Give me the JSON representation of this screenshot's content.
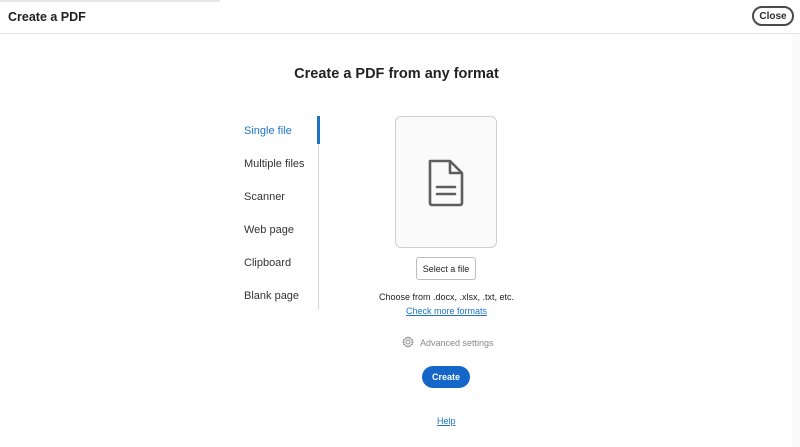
{
  "header": {
    "title": "Create a PDF",
    "close_label": "Close"
  },
  "main": {
    "heading": "Create a PDF from any format",
    "nav": [
      {
        "label": "Single file",
        "active": true
      },
      {
        "label": "Multiple files",
        "active": false
      },
      {
        "label": "Scanner",
        "active": false
      },
      {
        "label": "Web page",
        "active": false
      },
      {
        "label": "Clipboard",
        "active": false
      },
      {
        "label": "Blank page",
        "active": false
      }
    ],
    "drop_icon": "document-icon",
    "select_file_label": "Select a file",
    "formats_text": "Choose from .docx, .xlsx, .txt, etc.",
    "formats_link": "Check more formats",
    "advanced_icon": "gear-icon",
    "advanced_label": "Advanced settings",
    "create_label": "Create",
    "help_label": "Help"
  },
  "colors": {
    "accent": "#1f74c8",
    "primary_button": "#1466c8"
  }
}
